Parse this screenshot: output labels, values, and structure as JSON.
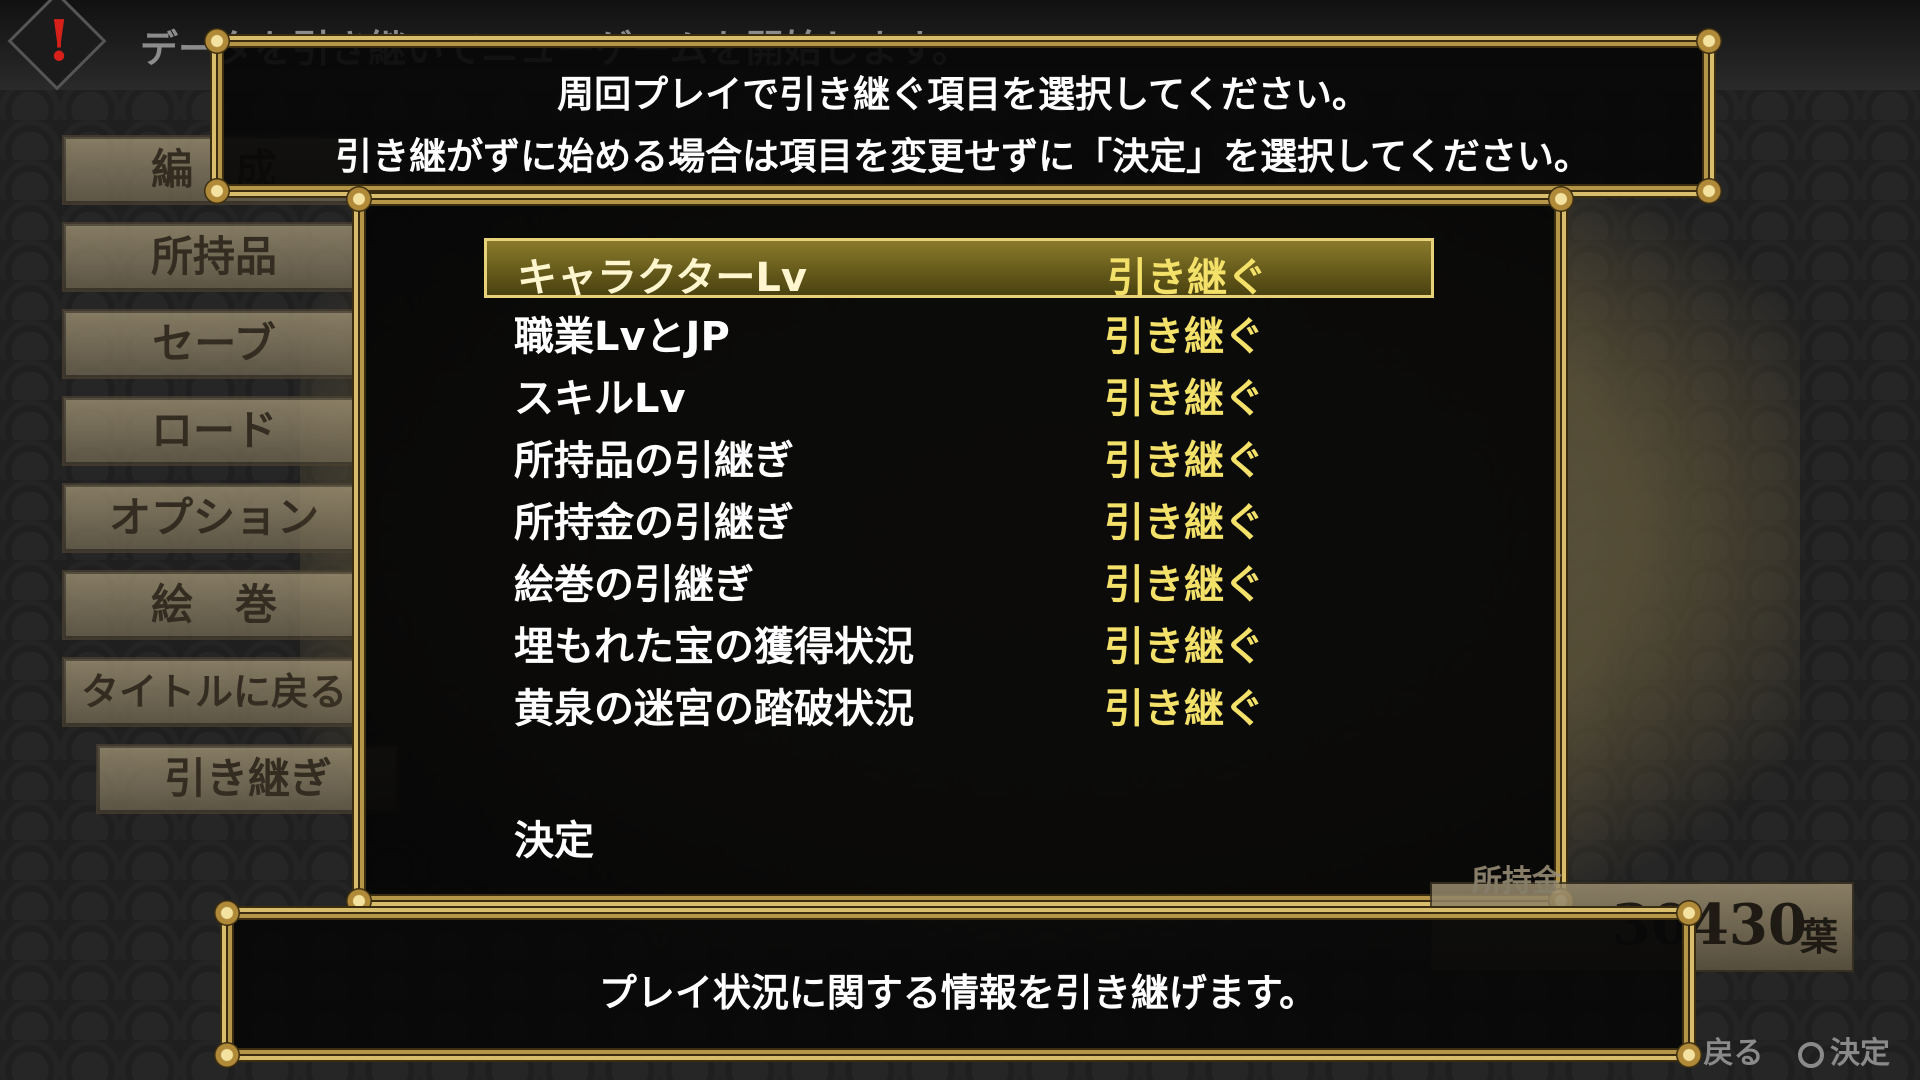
{
  "top_caption": "データを引き継いでニューゲームを開始します。",
  "instructions": {
    "line1": "周回プレイで引き継ぐ項目を選択してください。",
    "line2": "引き継がずに始める場合は項目を変更せずに「決定」を選択してください。"
  },
  "side_menu": {
    "items": [
      {
        "label": "編　成"
      },
      {
        "label": "所持品"
      },
      {
        "label": "セーブ"
      },
      {
        "label": "ロード"
      },
      {
        "label": "オプション"
      },
      {
        "label": "絵　巻"
      },
      {
        "label": "タイトルに戻る"
      },
      {
        "label": "引き継ぎ",
        "active": true
      }
    ]
  },
  "carryover": {
    "selected_index": 0,
    "options": [
      {
        "label": "キャラクターLv",
        "value": "引き継ぐ"
      },
      {
        "label": "職業LvとJP",
        "value": "引き継ぐ"
      },
      {
        "label": "スキルLv",
        "value": "引き継ぐ"
      },
      {
        "label": "所持品の引継ぎ",
        "value": "引き継ぐ"
      },
      {
        "label": "所持金の引継ぎ",
        "value": "引き継ぐ"
      },
      {
        "label": "絵巻の引継ぎ",
        "value": "引き継ぐ"
      },
      {
        "label": "埋もれた宝の獲得状況",
        "value": "引き継ぐ"
      },
      {
        "label": "黄泉の迷宮の踏破状況",
        "value": "引き継ぐ"
      }
    ],
    "confirm_label": "決定"
  },
  "money": {
    "caption": "所持金",
    "amount": "30430",
    "unit": "葉"
  },
  "description": "プレイ状況に関する情報を引き継げます。",
  "button_hints": {
    "back": "戻る",
    "confirm": "決定"
  },
  "colors": {
    "gold_frame": "#b59547",
    "value_yellow": "#f4e16a",
    "warning_red": "#d8201a"
  },
  "icons": [
    "warning-icon",
    "circle-button-icon"
  ]
}
